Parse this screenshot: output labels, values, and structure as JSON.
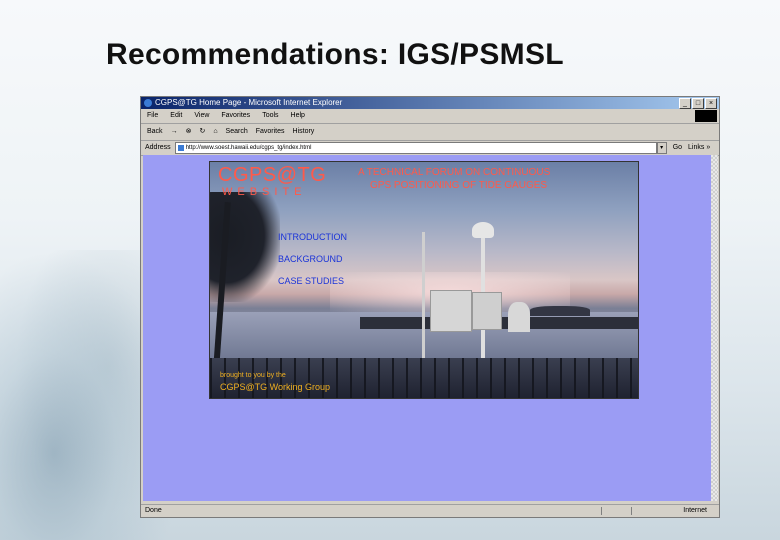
{
  "slide": {
    "title": "Recommendations: IGS/PSMSL"
  },
  "browser": {
    "window_title": "CGPS@TG Home Page - Microsoft Internet Explorer",
    "window_buttons": [
      "_",
      "□",
      "×"
    ],
    "menu": [
      "File",
      "Edit",
      "View",
      "Favorites",
      "Tools",
      "Help"
    ],
    "toolbar": [
      "Back",
      "→",
      "⊗",
      "↻",
      "⌂",
      "Search",
      "Favorites",
      "History"
    ],
    "address_label": "Address",
    "address_value": "http://www.soest.hawaii.edu/cgps_tg/index.html",
    "go_label": "Go",
    "links_label": "Links »",
    "status_left": "Done",
    "status_right": "Internet"
  },
  "page": {
    "site_title": "CGPS@TG",
    "site_subtitle": "WEBSITE",
    "forum_line1": "A TECHNICAL FORUM ON CONTINUOUS",
    "forum_line2": "GPS POSITIONING OF TIDE GAUGES",
    "nav": [
      "INTRODUCTION",
      "BACKGROUND",
      "CASE STUDIES"
    ],
    "credit_line1": "brought to you by the",
    "credit_line2": "CGPS@TG Working Group"
  }
}
